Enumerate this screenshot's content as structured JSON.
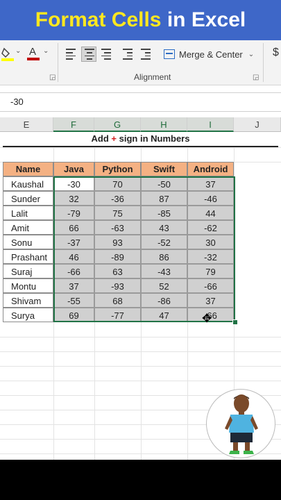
{
  "banner": {
    "part1": "Format Cells",
    "part2": "in Excel"
  },
  "ribbon": {
    "merge_label": "Merge & Center",
    "group_label": "Alignment",
    "currency_symbol": "$"
  },
  "formula_bar": {
    "value": "-30"
  },
  "columns": [
    "E",
    "F",
    "G",
    "H",
    "I",
    "J"
  ],
  "title": {
    "before": "Add",
    "plus": "+",
    "after": "sign in Numbers"
  },
  "table": {
    "headers": [
      "Name",
      "Java",
      "Python",
      "Swift",
      "Android"
    ],
    "rows": [
      [
        "Kaushal",
        "-30",
        "70",
        "-50",
        "37"
      ],
      [
        "Sunder",
        "32",
        "-36",
        "87",
        "-46"
      ],
      [
        "Lalit",
        "-79",
        "75",
        "-85",
        "44"
      ],
      [
        "Amit",
        "66",
        "-63",
        "43",
        "-62"
      ],
      [
        "Sonu",
        "-37",
        "93",
        "-52",
        "30"
      ],
      [
        "Prashant",
        "46",
        "-89",
        "86",
        "-32"
      ],
      [
        "Suraj",
        "-66",
        "63",
        "-43",
        "79"
      ],
      [
        "Montu",
        "37",
        "-93",
        "52",
        "-66"
      ],
      [
        "Shivam",
        "-55",
        "68",
        "-86",
        "37"
      ],
      [
        "Surya",
        "69",
        "-77",
        "47",
        "-66"
      ]
    ]
  },
  "colors": {
    "banner_bg": "#3e67c8",
    "banner_accent": "#ffe81f",
    "header_fill": "#f4b183",
    "selection": "#217346",
    "plus_red": "#d21f1f"
  },
  "icons": [
    "fill-color-icon",
    "font-color-icon",
    "align-left-icon",
    "align-center-icon",
    "align-right-icon",
    "decrease-indent-icon",
    "increase-indent-icon",
    "merge-center-icon",
    "dialog-launcher-icon",
    "move-cursor-icon",
    "character-avatar"
  ]
}
